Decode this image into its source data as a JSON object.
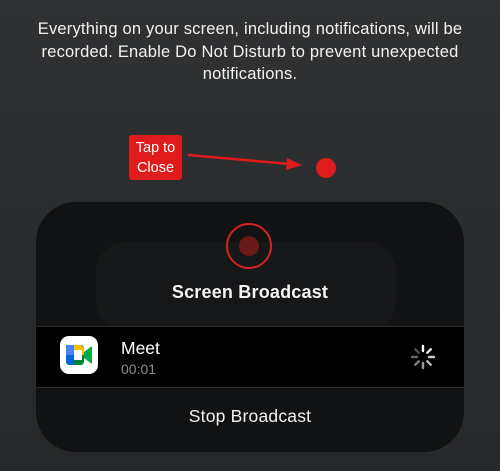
{
  "notice": {
    "text": "Everything on your screen, including notifications, will be recorded. Enable Do Not Disturb to prevent unexpected notifications."
  },
  "annotation": {
    "label": "Tap to\nClose",
    "color": "#e01b1b"
  },
  "broadcast_sheet": {
    "title": "Screen Broadcast",
    "record_icon": "record-icon",
    "record_color": "#d42121",
    "app": {
      "name": "Meet",
      "elapsed": "00:01",
      "icon": "google-meet-icon"
    },
    "status_icon": "loading-spinner-icon",
    "stop_label": "Stop Broadcast"
  }
}
